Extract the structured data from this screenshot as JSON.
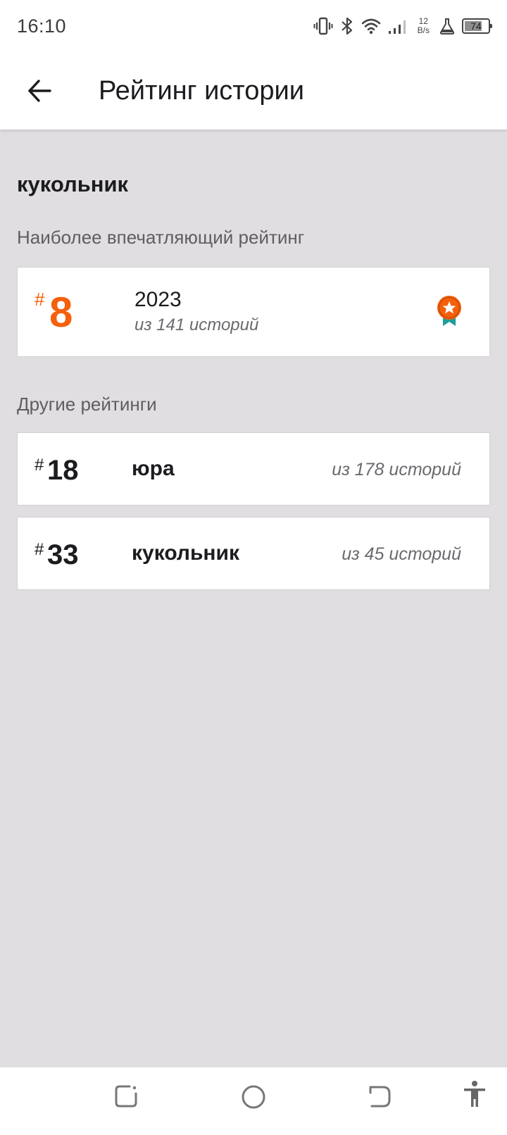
{
  "status": {
    "time": "16:10",
    "net_speed_value": "12",
    "net_speed_unit": "B/s",
    "battery": "74",
    "battery_level": 0.74
  },
  "header": {
    "title": "Рейтинг истории"
  },
  "story": {
    "name": "кукольник"
  },
  "top_ranking": {
    "section_label": "Наиболее впечатляющий рейтинг",
    "hash": "#",
    "rank": "8",
    "tag": "2023",
    "of_text": "из 141 историй",
    "accent_color": "#f4600c",
    "icon": "award-ribbon-icon"
  },
  "other_rankings": {
    "section_label": "Другие рейтинги",
    "items": [
      {
        "hash": "#",
        "rank": "18",
        "tag": "юра",
        "of_text": "из 178 историй"
      },
      {
        "hash": "#",
        "rank": "33",
        "tag": "кукольник",
        "of_text": "из 45 историй"
      }
    ]
  },
  "navigation": {
    "icons": [
      "recent-apps-icon",
      "home-icon",
      "back-nav-icon",
      "accessibility-icon"
    ]
  }
}
